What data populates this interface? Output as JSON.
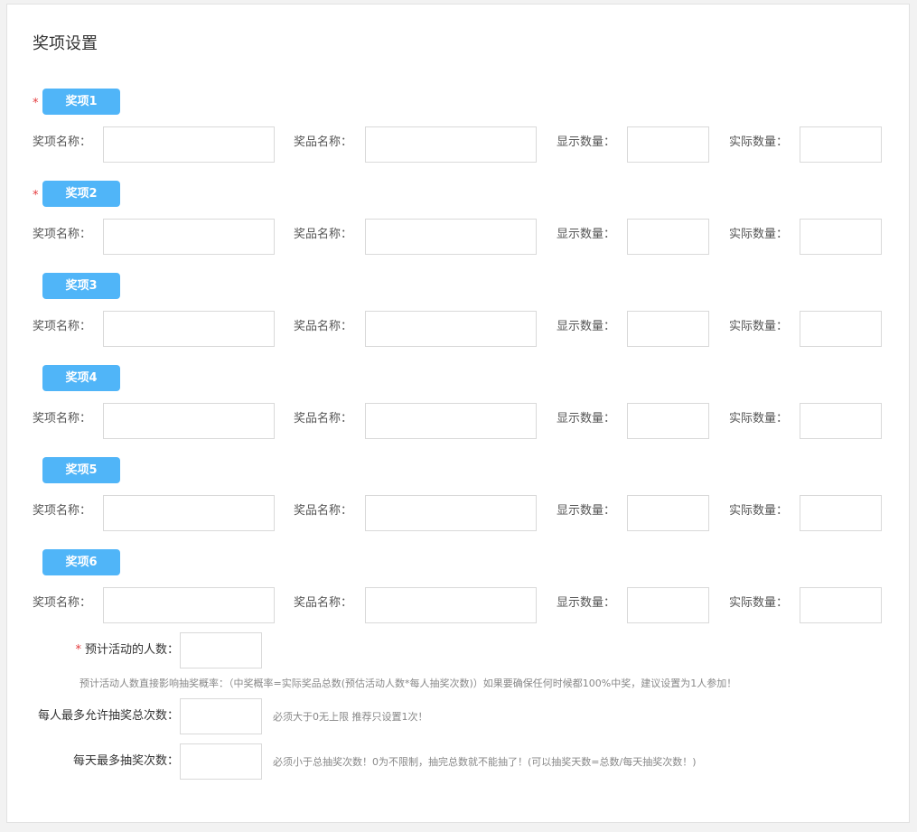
{
  "page": {
    "title": "奖项设置"
  },
  "prize_field_labels": {
    "prize_name": "奖项名称：",
    "goods_name": "奖品名称：",
    "display_qty": "显示数量：",
    "actual_qty": "实际数量："
  },
  "prizes": [
    {
      "label": "奖项1",
      "required": true,
      "prize_name": "",
      "goods_name": "",
      "display_qty": "",
      "actual_qty": ""
    },
    {
      "label": "奖项2",
      "required": true,
      "prize_name": "",
      "goods_name": "",
      "display_qty": "",
      "actual_qty": ""
    },
    {
      "label": "奖项3",
      "required": false,
      "prize_name": "",
      "goods_name": "",
      "display_qty": "",
      "actual_qty": ""
    },
    {
      "label": "奖项4",
      "required": false,
      "prize_name": "",
      "goods_name": "",
      "display_qty": "",
      "actual_qty": ""
    },
    {
      "label": "奖项5",
      "required": false,
      "prize_name": "",
      "goods_name": "",
      "display_qty": "",
      "actual_qty": ""
    },
    {
      "label": "奖项6",
      "required": false,
      "prize_name": "",
      "goods_name": "",
      "display_qty": "",
      "actual_qty": ""
    }
  ],
  "required_marker": "*",
  "expected_participants": {
    "label": "预计活动的人数：",
    "value": "",
    "note": "预计活动人数直接影响抽奖概率：（中奖概率=实际奖品总数(预估活动人数*每人抽奖次数)）如果要确保任何时候都100%中奖，建议设置为1人参加！"
  },
  "max_total_draws": {
    "label": "每人最多允许抽奖总次数：",
    "value": "",
    "hint": "必须大于0无上限 推荐只设置1次！"
  },
  "max_daily_draws": {
    "label": "每天最多抽奖次数：",
    "value": "",
    "hint": "必须小于总抽奖次数！0为不限制，抽完总数就不能抽了！(可以抽奖天数=总数/每天抽奖次数！)"
  },
  "colors": {
    "badge": "#50b5f8",
    "required": "#e4393c"
  }
}
